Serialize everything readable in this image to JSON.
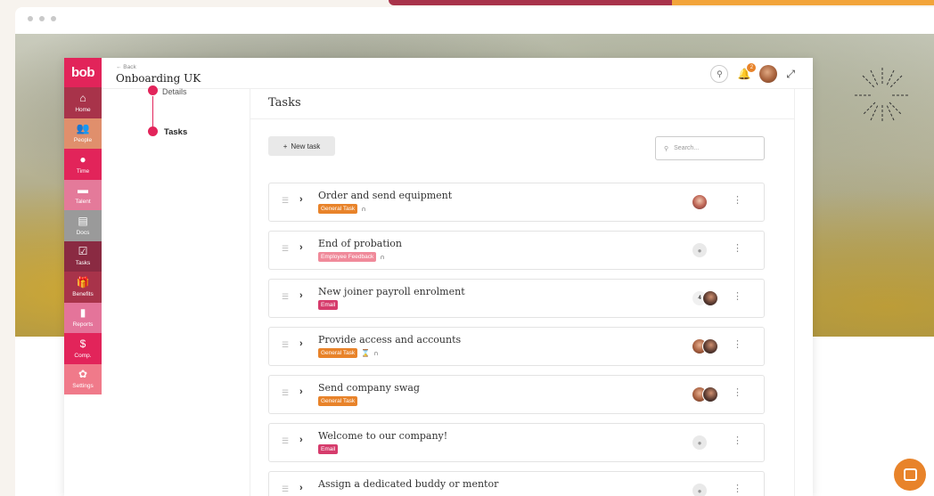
{
  "app": {
    "logo": "bob",
    "back_label": "← Back",
    "title": "Onboarding UK"
  },
  "colors": {
    "brand": "#e2245a",
    "accent": "#e8832a"
  },
  "sidebar": {
    "items": [
      {
        "label": "Home",
        "icon": "⌂",
        "icon_name": "home-icon",
        "color": "#a8334a"
      },
      {
        "label": "People",
        "icon": "👥",
        "icon_name": "people-icon",
        "color": "#e08f6c"
      },
      {
        "label": "Time",
        "icon": "●",
        "icon_name": "clock-icon",
        "color": "#e2245a"
      },
      {
        "label": "Talent",
        "icon": "▬",
        "icon_name": "chat-icon",
        "color": "#e47a9a"
      },
      {
        "label": "Docs",
        "icon": "▤",
        "icon_name": "document-icon",
        "color": "#9a9a9a"
      },
      {
        "label": "Tasks",
        "icon": "☑",
        "icon_name": "checkbox-icon",
        "color": "#8a2a42"
      },
      {
        "label": "Benefits",
        "icon": "🎁",
        "icon_name": "gift-icon",
        "color": "#a8334a"
      },
      {
        "label": "Reports",
        "icon": "▮",
        "icon_name": "chart-icon",
        "color": "#e4749a"
      },
      {
        "label": "Comp.",
        "icon": "$",
        "icon_name": "money-icon",
        "color": "#e2245a"
      },
      {
        "label": "Settings",
        "icon": "✿",
        "icon_name": "gear-icon",
        "color": "#f07a8a"
      }
    ]
  },
  "header": {
    "notification_count": "2"
  },
  "steps": {
    "details": "Details",
    "tasks": "Tasks"
  },
  "main": {
    "title": "Tasks",
    "new_task_label": "New task",
    "search_placeholder": "Search...",
    "tasks": [
      {
        "name": "Order and send equipment",
        "tag": "General Task",
        "tag_color": "#e8832a",
        "assignee": "photo"
      },
      {
        "name": "End of probation",
        "tag": "Employee Feedback",
        "tag_color": "#f08a9a",
        "assignee": "placeholder"
      },
      {
        "name": "New joiner payroll enrolment",
        "tag": "Email",
        "tag_color": "#d63c6c",
        "assignee": "count",
        "count": "4"
      },
      {
        "name": "Provide access and accounts",
        "tag": "General Task",
        "tag_color": "#e8832a",
        "assignee": "photos"
      },
      {
        "name": "Send company swag",
        "tag": "General Task",
        "tag_color": "#e8832a",
        "assignee": "photos"
      },
      {
        "name": "Welcome to our company!",
        "tag": "Email",
        "tag_color": "#d63c6c",
        "assignee": "placeholder"
      },
      {
        "name": "Assign a dedicated buddy or mentor",
        "tag": "",
        "tag_color": "",
        "assignee": "placeholder"
      }
    ]
  }
}
